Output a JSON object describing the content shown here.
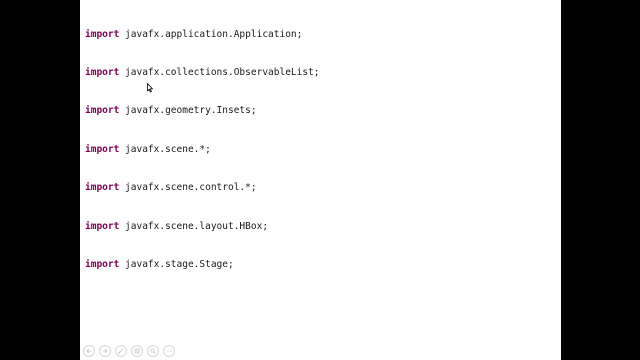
{
  "window": {
    "background": "#000000",
    "slide_background": "#ffffff"
  },
  "code": {
    "keyword_color": "#7f0055",
    "text_color": "#1a1a1a",
    "lines": [
      {
        "keyword": "import",
        "text": " javafx.application.Application;"
      },
      {
        "keyword": "import",
        "text": " javafx.collections.ObservableList;"
      },
      {
        "keyword": "import",
        "text": " javafx.geometry.Insets;"
      },
      {
        "keyword": "import",
        "text": " javafx.scene.*;"
      },
      {
        "keyword": "import",
        "text": " javafx.scene.control.*;"
      },
      {
        "keyword": "import",
        "text": " javafx.scene.layout.HBox;"
      },
      {
        "keyword": "import",
        "text": " javafx.stage.Stage;"
      }
    ]
  },
  "slideshow_toolbar": {
    "buttons": [
      {
        "name": "previous-slide-button",
        "icon": "arrow-left-icon"
      },
      {
        "name": "next-slide-button",
        "icon": "arrow-right-icon"
      },
      {
        "name": "pen-button",
        "icon": "pen-icon"
      },
      {
        "name": "all-slides-button",
        "icon": "slides-grid-icon"
      },
      {
        "name": "zoom-button",
        "icon": "magnifier-icon"
      },
      {
        "name": "more-options-button",
        "icon": "more-icon"
      }
    ]
  }
}
